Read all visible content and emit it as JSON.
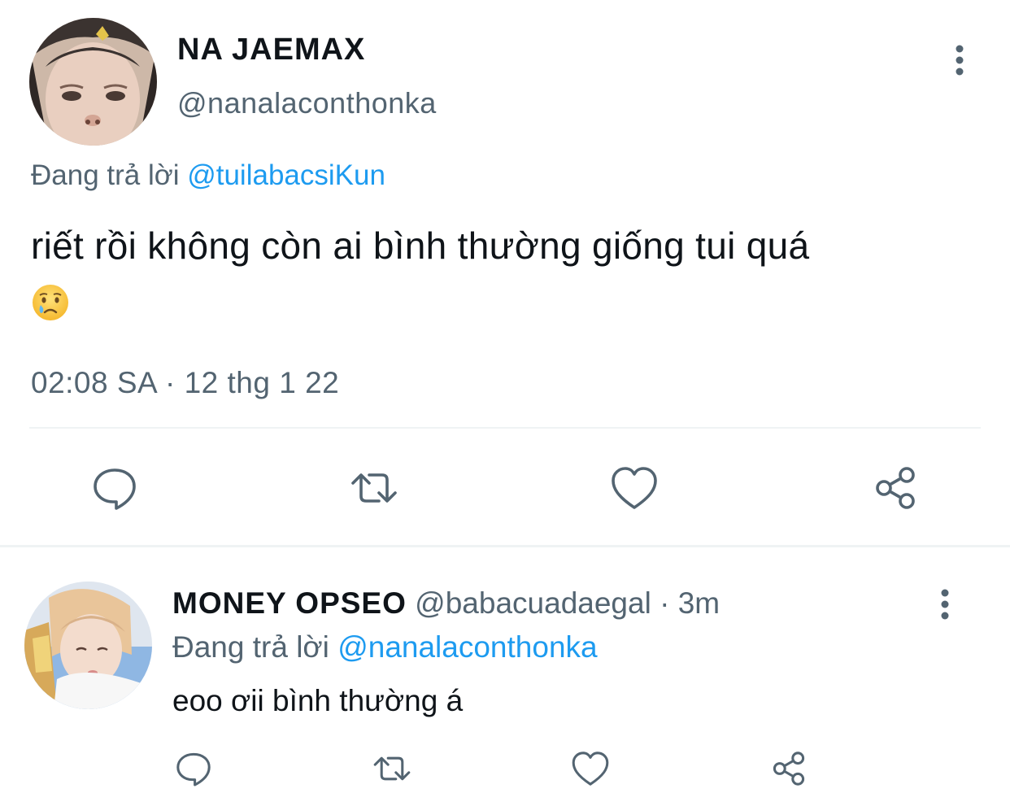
{
  "main_tweet": {
    "display_name": "NA JAEMAX",
    "handle": "@nanalaconthonka",
    "replying_prefix": "Đang trả lời",
    "replying_to": "@tuilabacsiKun",
    "text": "riết rồi không còn ai bình thường giống tui quá",
    "emoji": "crying-face-emoji",
    "timestamp": "02:08 SA · 12 thg 1 22",
    "actions": [
      "reply-icon",
      "retweet-icon",
      "like-icon",
      "share-icon"
    ]
  },
  "reply_tweet": {
    "display_name": "MONEY OPSEO",
    "handle": "@babacuadaegal",
    "separator": " · ",
    "time_ago": "3m",
    "replying_prefix": "Đang trả lời",
    "replying_to": "@nanalaconthonka",
    "text": "eoo ơii bình thường á",
    "actions": [
      "reply-icon",
      "retweet-icon",
      "like-icon",
      "share-icon"
    ]
  },
  "colors": {
    "text_primary": "#0f1419",
    "text_secondary": "#536471",
    "link": "#1d9bf0",
    "divider": "#eff3f4"
  }
}
